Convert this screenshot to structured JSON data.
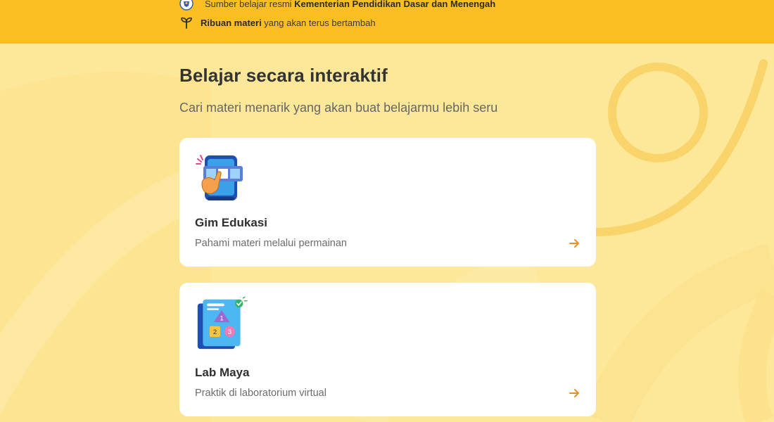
{
  "banner": {
    "source_prefix": "Sumber belajar resmi ",
    "source_bold": "Kementerian Pendidikan Dasar dan Menengah",
    "materials_bold": "Ribuan materi",
    "materials_rest": " yang akan terus bertambah",
    "icons": [
      "government-seal-icon",
      "sprout-icon"
    ]
  },
  "section": {
    "title": "Belajar secara interaktif",
    "subtitle": "Cari materi menarik yang akan buat belajarmu lebih seru"
  },
  "cards": [
    {
      "title": "Gim Edukasi",
      "description": "Pahami materi melalui permainan",
      "icon": "tablet-game-icon",
      "arrow": "arrow-right-icon"
    },
    {
      "title": "Lab Maya",
      "description": "Praktik di laboratorium virtual",
      "icon": "lab-shapes-icon",
      "illustration_numbers": [
        "1",
        "2",
        "3"
      ],
      "arrow": "arrow-right-icon"
    }
  ],
  "colors": {
    "banner": "#fbbf24",
    "background": "#fde89a",
    "accent": "#e8902a",
    "card": "#ffffff"
  }
}
